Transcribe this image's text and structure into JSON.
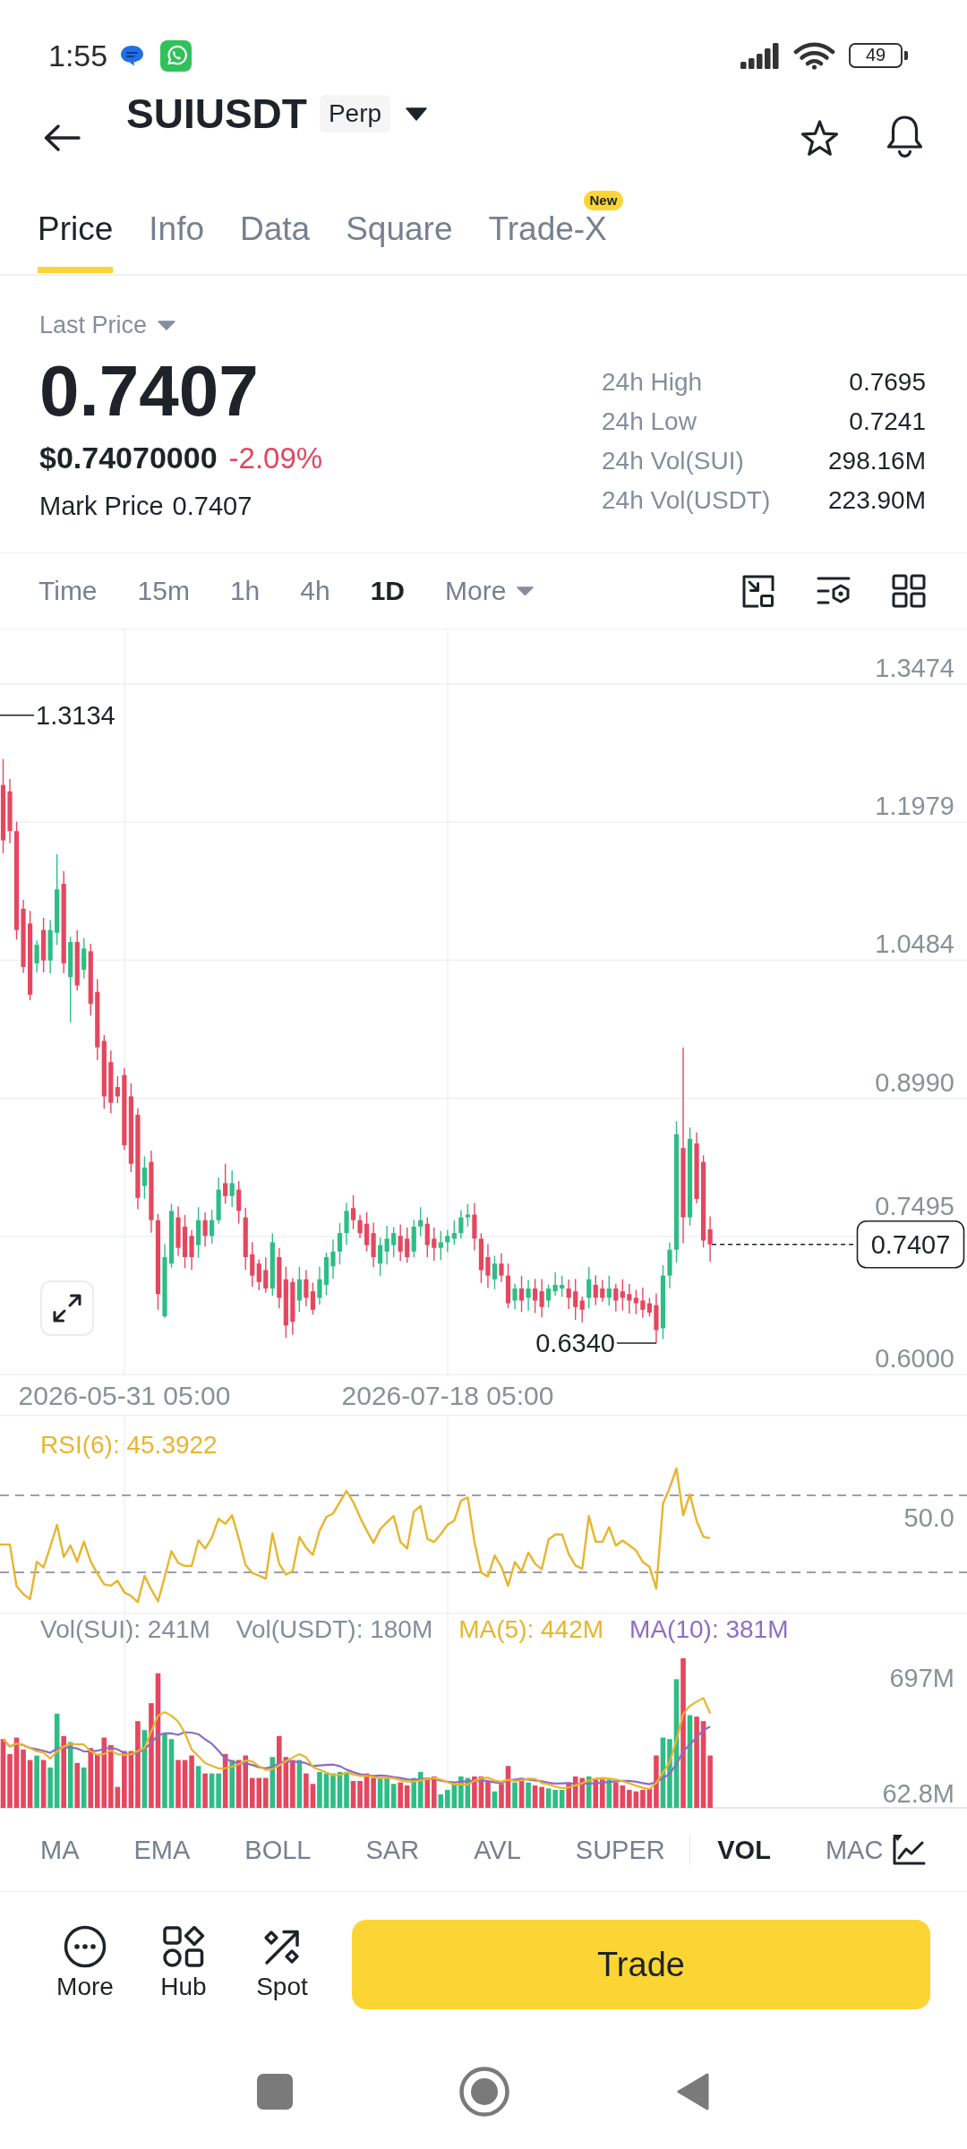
{
  "status_bar": {
    "time": "1:55",
    "battery": "49"
  },
  "header": {
    "symbol": "SUIUSDT",
    "contract_type": "Perp"
  },
  "tabs": [
    {
      "label": "Price",
      "selected": true
    },
    {
      "label": "Info",
      "selected": false
    },
    {
      "label": "Data",
      "selected": false
    },
    {
      "label": "Square",
      "selected": false
    },
    {
      "label": "Trade-X",
      "selected": false,
      "badge": "New"
    }
  ],
  "price_summary": {
    "price_type": "Last Price",
    "last_price": "0.7407",
    "usd_price": "$0.74070000",
    "change": "-2.09%",
    "mark_price_label": "Mark Price",
    "mark_price": "0.7407"
  },
  "stats": [
    {
      "label": "24h High",
      "value": "0.7695"
    },
    {
      "label": "24h Low",
      "value": "0.7241"
    },
    {
      "label": "24h Vol(SUI)",
      "value": "298.16M"
    },
    {
      "label": "24h Vol(USDT)",
      "value": "223.90M"
    }
  ],
  "intervals": [
    {
      "label": "Time",
      "kind": "interval",
      "selected": false
    },
    {
      "label": "15m",
      "kind": "interval",
      "selected": false
    },
    {
      "label": "1h",
      "kind": "interval",
      "selected": false
    },
    {
      "label": "4h",
      "kind": "interval",
      "selected": false
    },
    {
      "label": "1D",
      "kind": "interval",
      "selected": true
    },
    {
      "label": "More",
      "kind": "dropdown",
      "selected": false
    }
  ],
  "price_chart": {
    "price_axis": [
      "1.3474",
      "1.1979",
      "1.0484",
      "0.8990",
      "0.7495",
      "0.6000"
    ],
    "date_axis": [
      "2026-05-31 05:00",
      "2026-07-18 05:00"
    ],
    "high_marker": "1.3134",
    "low_marker": "0.6340",
    "last_price_tag": "0.7407"
  },
  "rsi": {
    "legend": "RSI(6): 45.3922",
    "axis": [
      "50.0"
    ]
  },
  "volume": {
    "legend": [
      {
        "text": "Vol(SUI): 241M",
        "color": "#848e9c"
      },
      {
        "text": "Vol(USDT): 180M",
        "color": "#848e9c"
      },
      {
        "text": "MA(5): 442M",
        "color": "#e8b52c"
      },
      {
        "text": "MA(10): 381M",
        "color": "#8e6cc2"
      }
    ],
    "axis": [
      "697M",
      "62.8M"
    ]
  },
  "main_indicators": [
    {
      "label": "MA",
      "selected": false
    },
    {
      "label": "EMA",
      "selected": false
    },
    {
      "label": "BOLL",
      "selected": false
    },
    {
      "label": "SAR",
      "selected": false
    },
    {
      "label": "AVL",
      "selected": false
    },
    {
      "label": "SUPER",
      "selected": false
    }
  ],
  "sub_indicators": [
    {
      "label": "VOL",
      "selected": true
    },
    {
      "label": "MAC",
      "selected": false
    }
  ],
  "actions": [
    {
      "label": "More"
    },
    {
      "label": "Hub"
    },
    {
      "label": "Spot"
    }
  ],
  "trade_button": "Trade"
}
